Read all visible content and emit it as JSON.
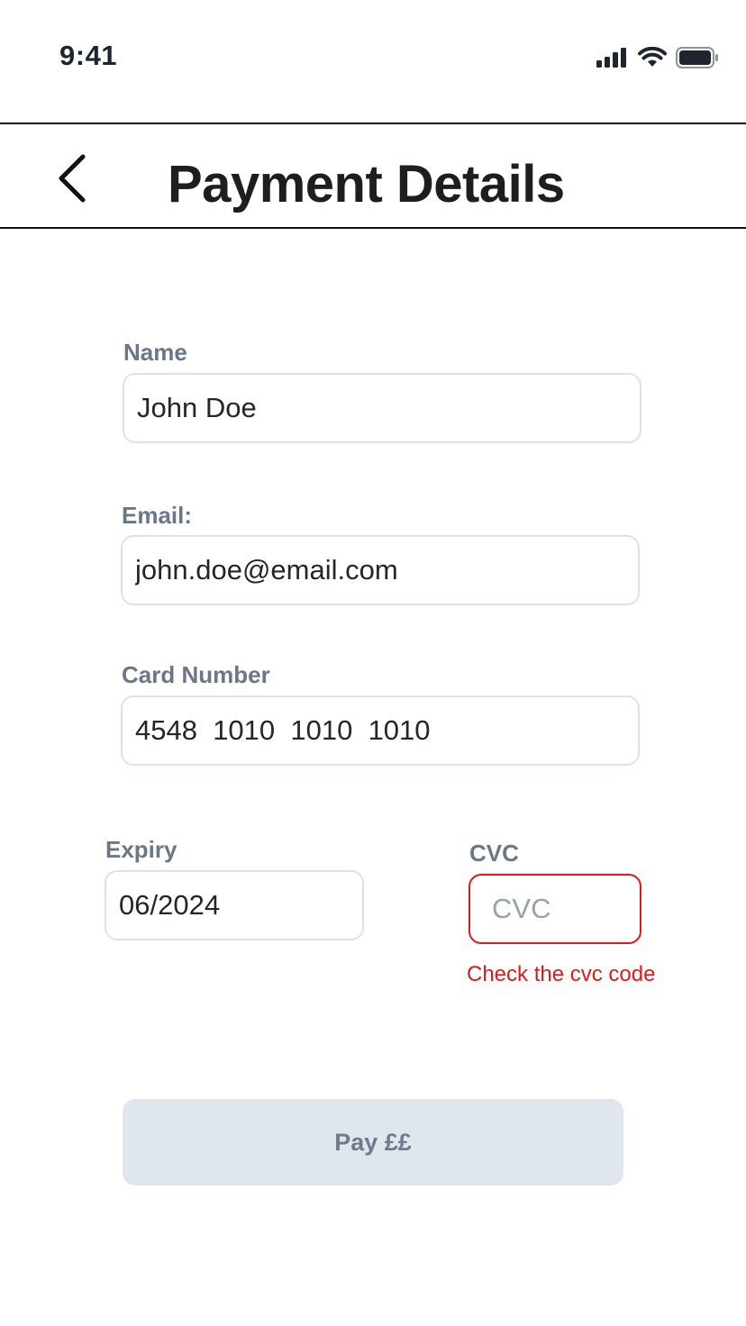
{
  "status_bar": {
    "time": "9:41",
    "icons": [
      "cellular-signal-icon",
      "wifi-icon",
      "battery-icon"
    ]
  },
  "header": {
    "title": "Payment Details",
    "back_icon": "chevron-left-icon"
  },
  "form": {
    "name": {
      "label": "Name",
      "value": "John Doe"
    },
    "email": {
      "label": "Email:",
      "value": "john.doe@email.com"
    },
    "card_number": {
      "label": "Card Number",
      "value": "4548  1010  1010  1010"
    },
    "expiry": {
      "label": "Expiry",
      "value": "06/2024"
    },
    "cvc": {
      "label": "CVC",
      "value": "",
      "placeholder": "CVC",
      "error": "Check the cvc code"
    }
  },
  "pay_button": {
    "label": "Pay ££"
  },
  "colors": {
    "label": "#6b7789",
    "input_border": "#dde2ea",
    "error": "#e01919",
    "button_bg": "#e0e6ee",
    "button_text": "#6f7a8c"
  }
}
